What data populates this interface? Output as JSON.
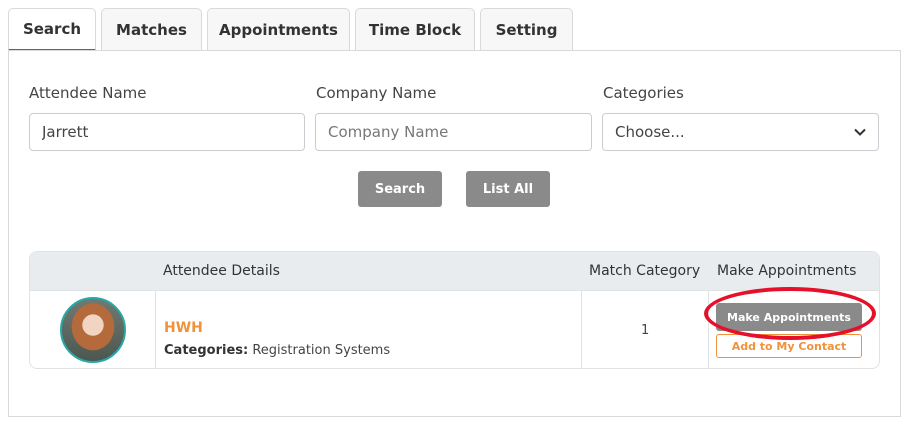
{
  "tabs": [
    {
      "label": "Search",
      "active": true
    },
    {
      "label": "Matches",
      "active": false
    },
    {
      "label": "Appointments",
      "active": false
    },
    {
      "label": "Time Block",
      "active": false
    },
    {
      "label": "Setting",
      "active": false
    }
  ],
  "search_form": {
    "attendee_name_label": "Attendee Name",
    "attendee_name_value": "Jarrett",
    "company_name_label": "Company Name",
    "company_name_placeholder": "Company Name",
    "categories_label": "Categories",
    "categories_selected": "Choose...",
    "search_button": "Search",
    "list_all_button": "List All"
  },
  "results_table": {
    "headers": {
      "attendee_details": "Attendee Details",
      "match_category": "Match Category",
      "make_appointments": "Make Appointments"
    },
    "rows": [
      {
        "name": "HWH",
        "categories_label": "Categories:",
        "categories_value": "Registration Systems",
        "match_count": "1",
        "make_appointments_button": "Make Appointments",
        "add_contact_button": "Add to My Contact"
      }
    ]
  },
  "colors": {
    "accent_orange": "#f0923a",
    "button_gray": "#8a8a8a",
    "annotation_red": "#e5102a",
    "active_tab_underline": "#4a6b85"
  }
}
